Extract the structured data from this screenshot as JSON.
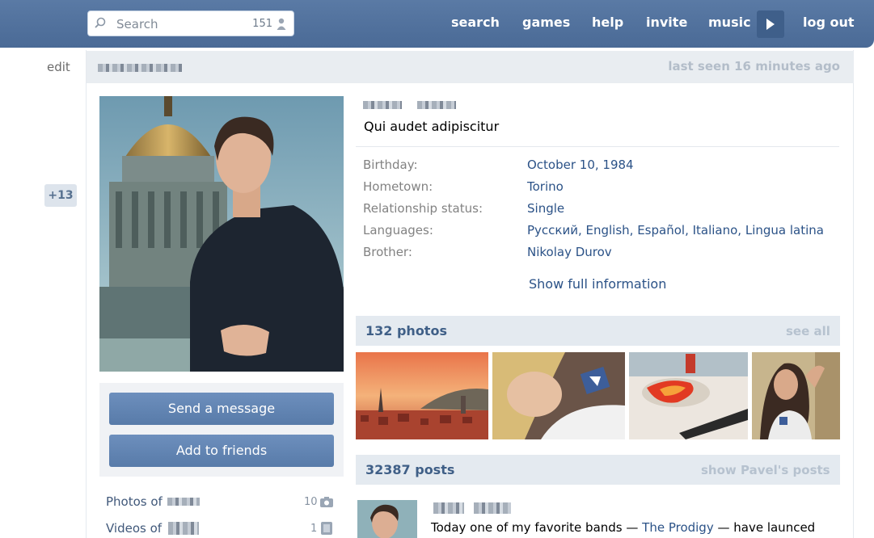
{
  "topbar": {
    "search_placeholder": "Search",
    "search_count": "151",
    "nav": [
      "search",
      "games",
      "help",
      "invite",
      "music",
      "log out"
    ]
  },
  "left": {
    "edit_label": "edit",
    "counter_badge": "+13"
  },
  "profile": {
    "last_seen": "last seen 16 minutes ago",
    "status": "Qui audet adipiscitur",
    "info": [
      {
        "label": "Birthday:",
        "value": "October 10, 1984"
      },
      {
        "label": "Hometown:",
        "value": "Torino"
      },
      {
        "label": "Relationship status:",
        "value": "Single"
      },
      {
        "label": "Languages:",
        "value": "Русский, English, Español, Italiano, Lingua latina"
      },
      {
        "label": "Brother:",
        "value": "Nikolay Durov"
      }
    ],
    "show_full": "Show full information"
  },
  "actions": {
    "send_message": "Send a message",
    "add_friends": "Add to friends"
  },
  "side_links": [
    {
      "label": "Photos of",
      "count": "10"
    },
    {
      "label": "Videos of",
      "count": "1"
    }
  ],
  "photos": {
    "title": "132 photos",
    "see_all": "see all"
  },
  "posts": {
    "title": "32387 posts",
    "show_link": "show Pavel's posts",
    "first_text_start": "Today one of my favorite bands — ",
    "first_link": "The Prodigy",
    "first_text_end": " — have launced"
  },
  "colors": {
    "header_blue": "#4e6e9a",
    "link_blue": "#2b5287",
    "button_blue": "#5f82b0"
  }
}
